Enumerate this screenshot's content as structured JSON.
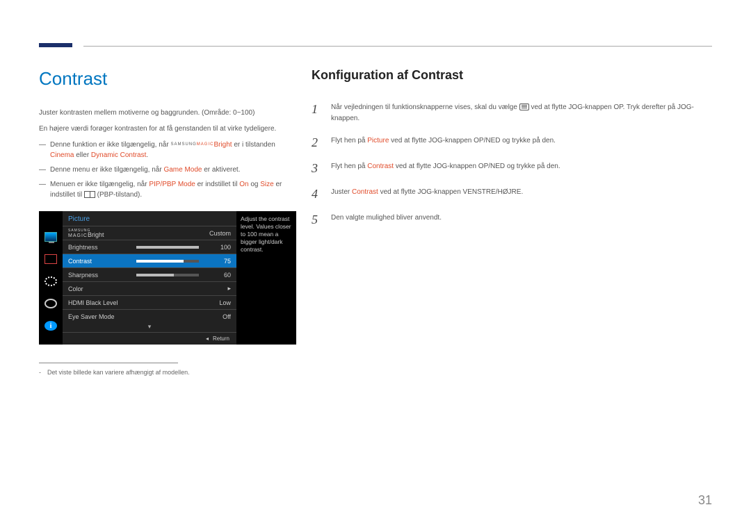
{
  "page_number": "31",
  "left": {
    "title": "Contrast",
    "intro1": "Juster kontrasten mellem motiverne og baggrunden. (Område: 0~100)",
    "intro2": "En højere værdi forøger kontrasten for at få genstanden til at virke tydeligere.",
    "notes": [
      {
        "pre": "Denne funktion er ikke tilgængelig, når ",
        "magic_sup": "SAMSUNG",
        "magic_sub": "MAGIC",
        "magic_label": "Bright",
        "mid": " er i tilstanden ",
        "hl1": "Cinema",
        "mid2": " eller ",
        "hl2": "Dynamic Contrast",
        "post": "."
      },
      {
        "pre": "Denne menu er ikke tilgængelig, når ",
        "hl1": "Game Mode",
        "post": " er aktiveret."
      },
      {
        "pre": "Menuen er ikke tilgængelig, når ",
        "hl1": "PIP/PBP Mode",
        "mid": " er indstillet til ",
        "hl2": "On",
        "mid2": " og ",
        "hl3": "Size",
        "mid3": " er indstillet til ",
        "icon": "pbp",
        "post": " (PBP-tilstand)."
      }
    ],
    "footnote": "Det viste billede kan variere afhængigt af modellen."
  },
  "osd": {
    "header": "Picture",
    "tip": "Adjust the contrast level. Values closer to 100 mean a bigger light/dark contrast.",
    "footer_label": "Return",
    "rows": [
      {
        "label_sup": "SAMSUNG",
        "label_sub": "MAGIC",
        "label": "Bright",
        "value": "Custom",
        "slider": null,
        "selected": false
      },
      {
        "label": "Brightness",
        "value": "100",
        "slider": 100,
        "selected": false
      },
      {
        "label": "Contrast",
        "value": "75",
        "slider": 75,
        "selected": true
      },
      {
        "label": "Sharpness",
        "value": "60",
        "slider": 60,
        "selected": false
      },
      {
        "label": "Color",
        "value": "▸",
        "slider": null,
        "selected": false
      },
      {
        "label": "HDMI Black Level",
        "value": "Low",
        "slider": null,
        "selected": false
      },
      {
        "label": "Eye Saver Mode",
        "value": "Off",
        "slider": null,
        "selected": false
      }
    ]
  },
  "right": {
    "title": "Konfiguration af Contrast",
    "steps": [
      {
        "num": "1",
        "pre": "Når vejledningen til funktionsknapperne vises, skal du vælge ",
        "icon": "menu",
        "post": " ved at flytte JOG-knappen OP. Tryk derefter på JOG-knappen."
      },
      {
        "num": "2",
        "pre": "Flyt hen på ",
        "hl": "Picture",
        "post": " ved at flytte JOG-knappen OP/NED og trykke på den."
      },
      {
        "num": "3",
        "pre": "Flyt hen på ",
        "hl": "Contrast",
        "post": " ved at flytte JOG-knappen OP/NED og trykke på den."
      },
      {
        "num": "4",
        "pre": "Juster ",
        "hl": "Contrast",
        "post": " ved at flytte JOG-knappen VENSTRE/HØJRE."
      },
      {
        "num": "5",
        "pre": "Den valgte mulighed bliver anvendt.",
        "hl": "",
        "post": ""
      }
    ]
  }
}
